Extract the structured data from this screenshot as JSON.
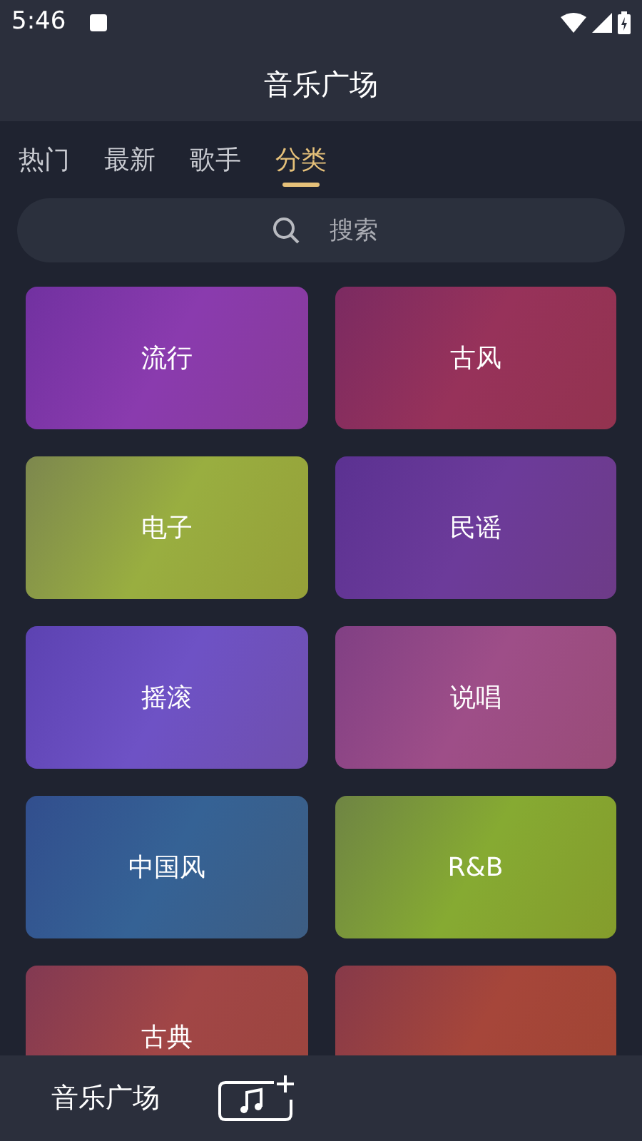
{
  "status_bar": {
    "time": "5:46"
  },
  "header": {
    "title": "音乐广场"
  },
  "tabs": [
    {
      "label": "热门",
      "selected": false
    },
    {
      "label": "最新",
      "selected": false
    },
    {
      "label": "歌手",
      "selected": false
    },
    {
      "label": "分类",
      "selected": true
    }
  ],
  "search": {
    "placeholder": "搜索"
  },
  "categories": [
    {
      "label": "流行",
      "color": "#8a3bae"
    },
    {
      "label": "古风",
      "color": "#97325a"
    },
    {
      "label": "电子",
      "color": "#99ae40"
    },
    {
      "label": "民谣",
      "color": "#6c3b9a"
    },
    {
      "label": "摇滚",
      "color": "#6e52c5"
    },
    {
      "label": "说唱",
      "color": "#9e4e88"
    },
    {
      "label": "中国风",
      "color": "#356295"
    },
    {
      "label": "R&B",
      "color": "#86aa32"
    },
    {
      "label": "古典",
      "color": "#a14646"
    },
    {
      "color": "#a6463a"
    }
  ],
  "bottom_nav": {
    "label": "音乐广场"
  }
}
